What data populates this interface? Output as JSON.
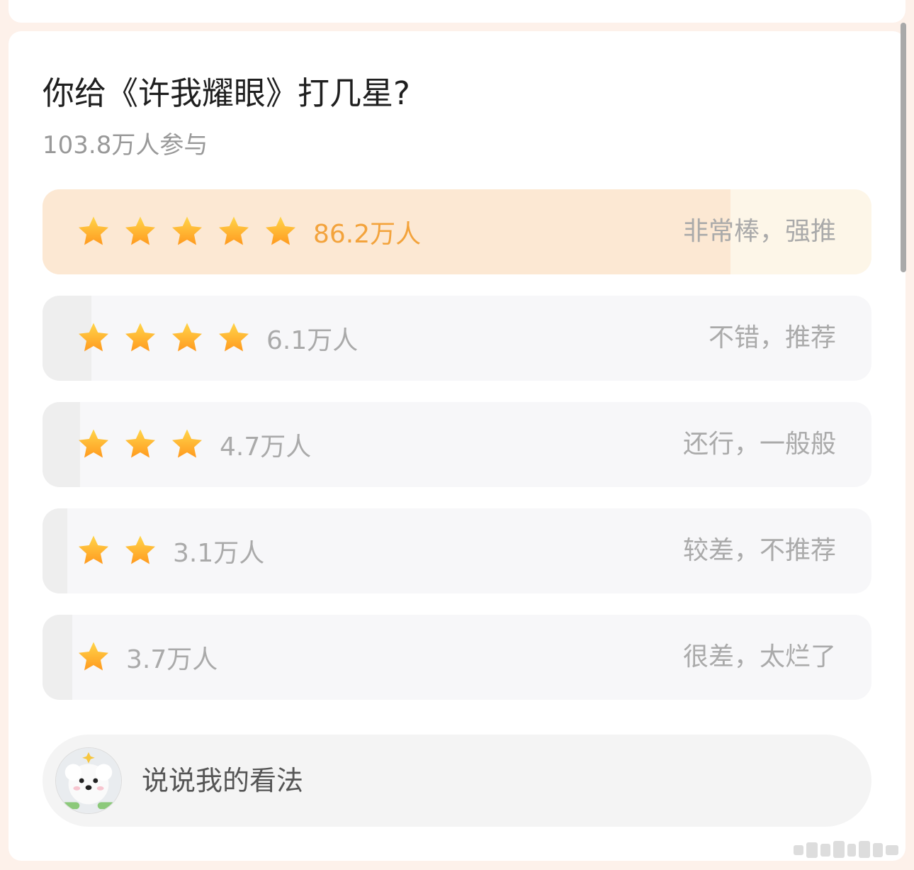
{
  "poll": {
    "title": "你给《许我耀眼》打几星?",
    "participants": "103.8万人参与",
    "options": [
      {
        "stars": 5,
        "count": "86.2万人",
        "label": "非常棒，强推",
        "share": 0.83,
        "selected": true
      },
      {
        "stars": 4,
        "count": "6.1万人",
        "label": "不错，推荐",
        "share": 0.059,
        "selected": false
      },
      {
        "stars": 3,
        "count": "4.7万人",
        "label": "还行，一般般",
        "share": 0.045,
        "selected": false
      },
      {
        "stars": 2,
        "count": "3.1万人",
        "label": "较差，不推荐",
        "share": 0.03,
        "selected": false
      },
      {
        "stars": 1,
        "count": "3.7万人",
        "label": "很差，太烂了",
        "share": 0.036,
        "selected": false
      }
    ]
  },
  "comment": {
    "placeholder": "说说我的看法",
    "avatar_icon": "white-dog-avatar"
  },
  "colors": {
    "page_background": "#fdf1ea",
    "card": "#ffffff",
    "selected_text": "#f3a33c",
    "selected_fill": "#fce8d3",
    "star_top": "#ffd54a",
    "star_bottom": "#ff9a1f",
    "muted_text": "#aaaaaa"
  },
  "icons": {
    "star": "star-icon",
    "watermark": "dotted-logo-watermark"
  }
}
